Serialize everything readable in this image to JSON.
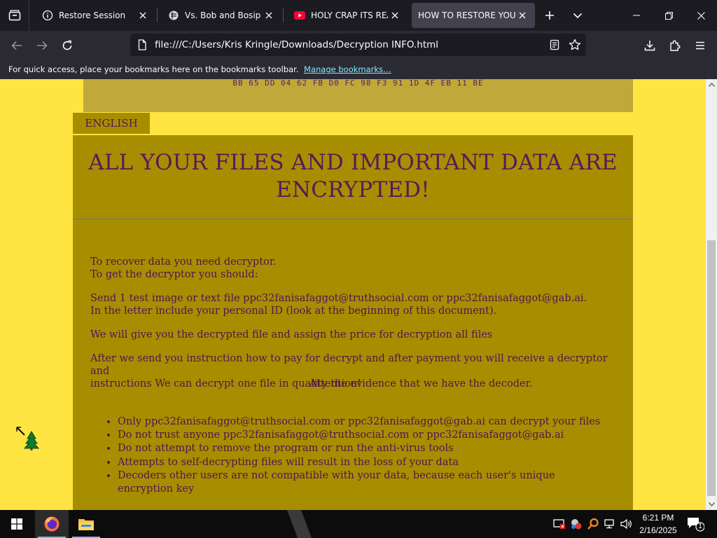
{
  "browser": {
    "tabs": [
      {
        "label": "Restore Session",
        "icon": "info-icon",
        "active": false
      },
      {
        "label": "Vs. Bob and Bosip | Fun",
        "icon": "site-icon",
        "active": false
      },
      {
        "label": "HOLY CRAP ITS REAL!! (",
        "icon": "youtube-icon",
        "active": false
      },
      {
        "label": "HOW TO RESTORE YOUR FI",
        "icon": "",
        "active": true
      }
    ],
    "url": "file:///C:/Users/Kris Kringle/Downloads/Decryption INFO.html",
    "bookmarks_prompt": "For quick access, place your bookmarks here on the bookmarks toolbar.",
    "bookmarks_link": "Manage bookmarks…"
  },
  "page": {
    "hex_line": "BB 65 DD 04 62 FB D0 FC 98 F3 91 1D 4F EB 11 BE",
    "lang_tab": "ENGLISH",
    "headline_1": "ALL YOUR FILES AND IMPORTANT DATA ARE",
    "headline_2": "ENCRYPTED!",
    "p1_line1": "To recover data you need decryptor.",
    "p1_line2": "To get the decryptor you should:",
    "p2_line1": "Send 1 test image or text file ppc32fanisafaggot@truthsocial.com or ppc32fanisafaggot@gab.ai.",
    "p2_line2": "In the letter include your personal ID (look at the beginning of this document).",
    "p3": "We will give you the decrypted file and assign the price for decryption all files",
    "p4_line1": "After we send you instruction how to pay for decrypt and after payment you will receive a decryptor and",
    "p4_line2": "instructions We can decrypt one file in quality the evidence that we have the decoder.",
    "attention": "Attention!",
    "bullets": [
      "Only ppc32fanisafaggot@truthsocial.com or ppc32fanisafaggot@gab.ai can decrypt your files",
      "Do not trust anyone ppc32fanisafaggot@truthsocial.com or ppc32fanisafaggot@gab.ai",
      "Do not attempt to remove the program or run the anti-virus tools",
      "Attempts to self-decrypting files will result in the loss of your data",
      "Decoders other users are not compatible with your data, because each user's unique encryption key"
    ]
  },
  "taskbar": {
    "time": "6:21 PM",
    "date": "2/16/2025",
    "notification_count": "1"
  },
  "colors": {
    "page_bg": "#ffe442",
    "panel_bg": "#a78e00",
    "text": "#4e1551",
    "headline": "#5e1759",
    "browser_chrome": "#2b2a33",
    "link": "#80ebff"
  }
}
